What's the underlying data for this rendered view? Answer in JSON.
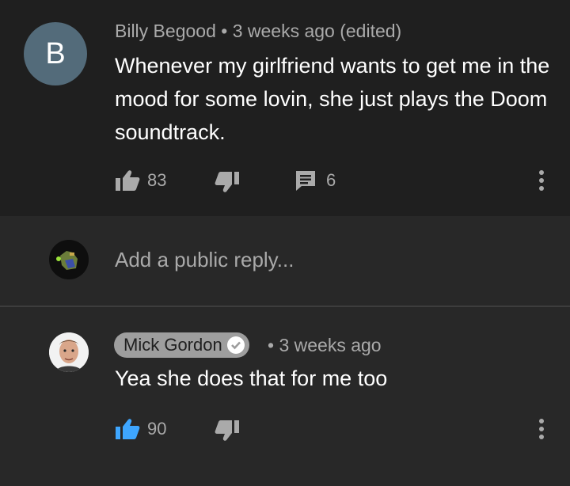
{
  "comment": {
    "avatar_letter": "B",
    "author": "Billy Begood",
    "separator": "•",
    "time": "3 weeks ago (edited)",
    "body": "Whenever my girlfriend wants to get me in the mood for some lovin, she just plays the Doom soundtrack.",
    "likes": "83",
    "replies": "6",
    "avatar_color": "#536b7a"
  },
  "reply_input": {
    "placeholder": "Add a public reply..."
  },
  "reply": {
    "author": "Mick Gordon",
    "time": "• 3 weeks ago",
    "body": "Yea she does that for me too",
    "likes": "90",
    "like_active_color": "#3ea6ff"
  },
  "icons": [
    "thumbs-up-icon",
    "thumbs-down-icon",
    "comment-icon",
    "more-vertical-icon",
    "verified-check-icon"
  ]
}
